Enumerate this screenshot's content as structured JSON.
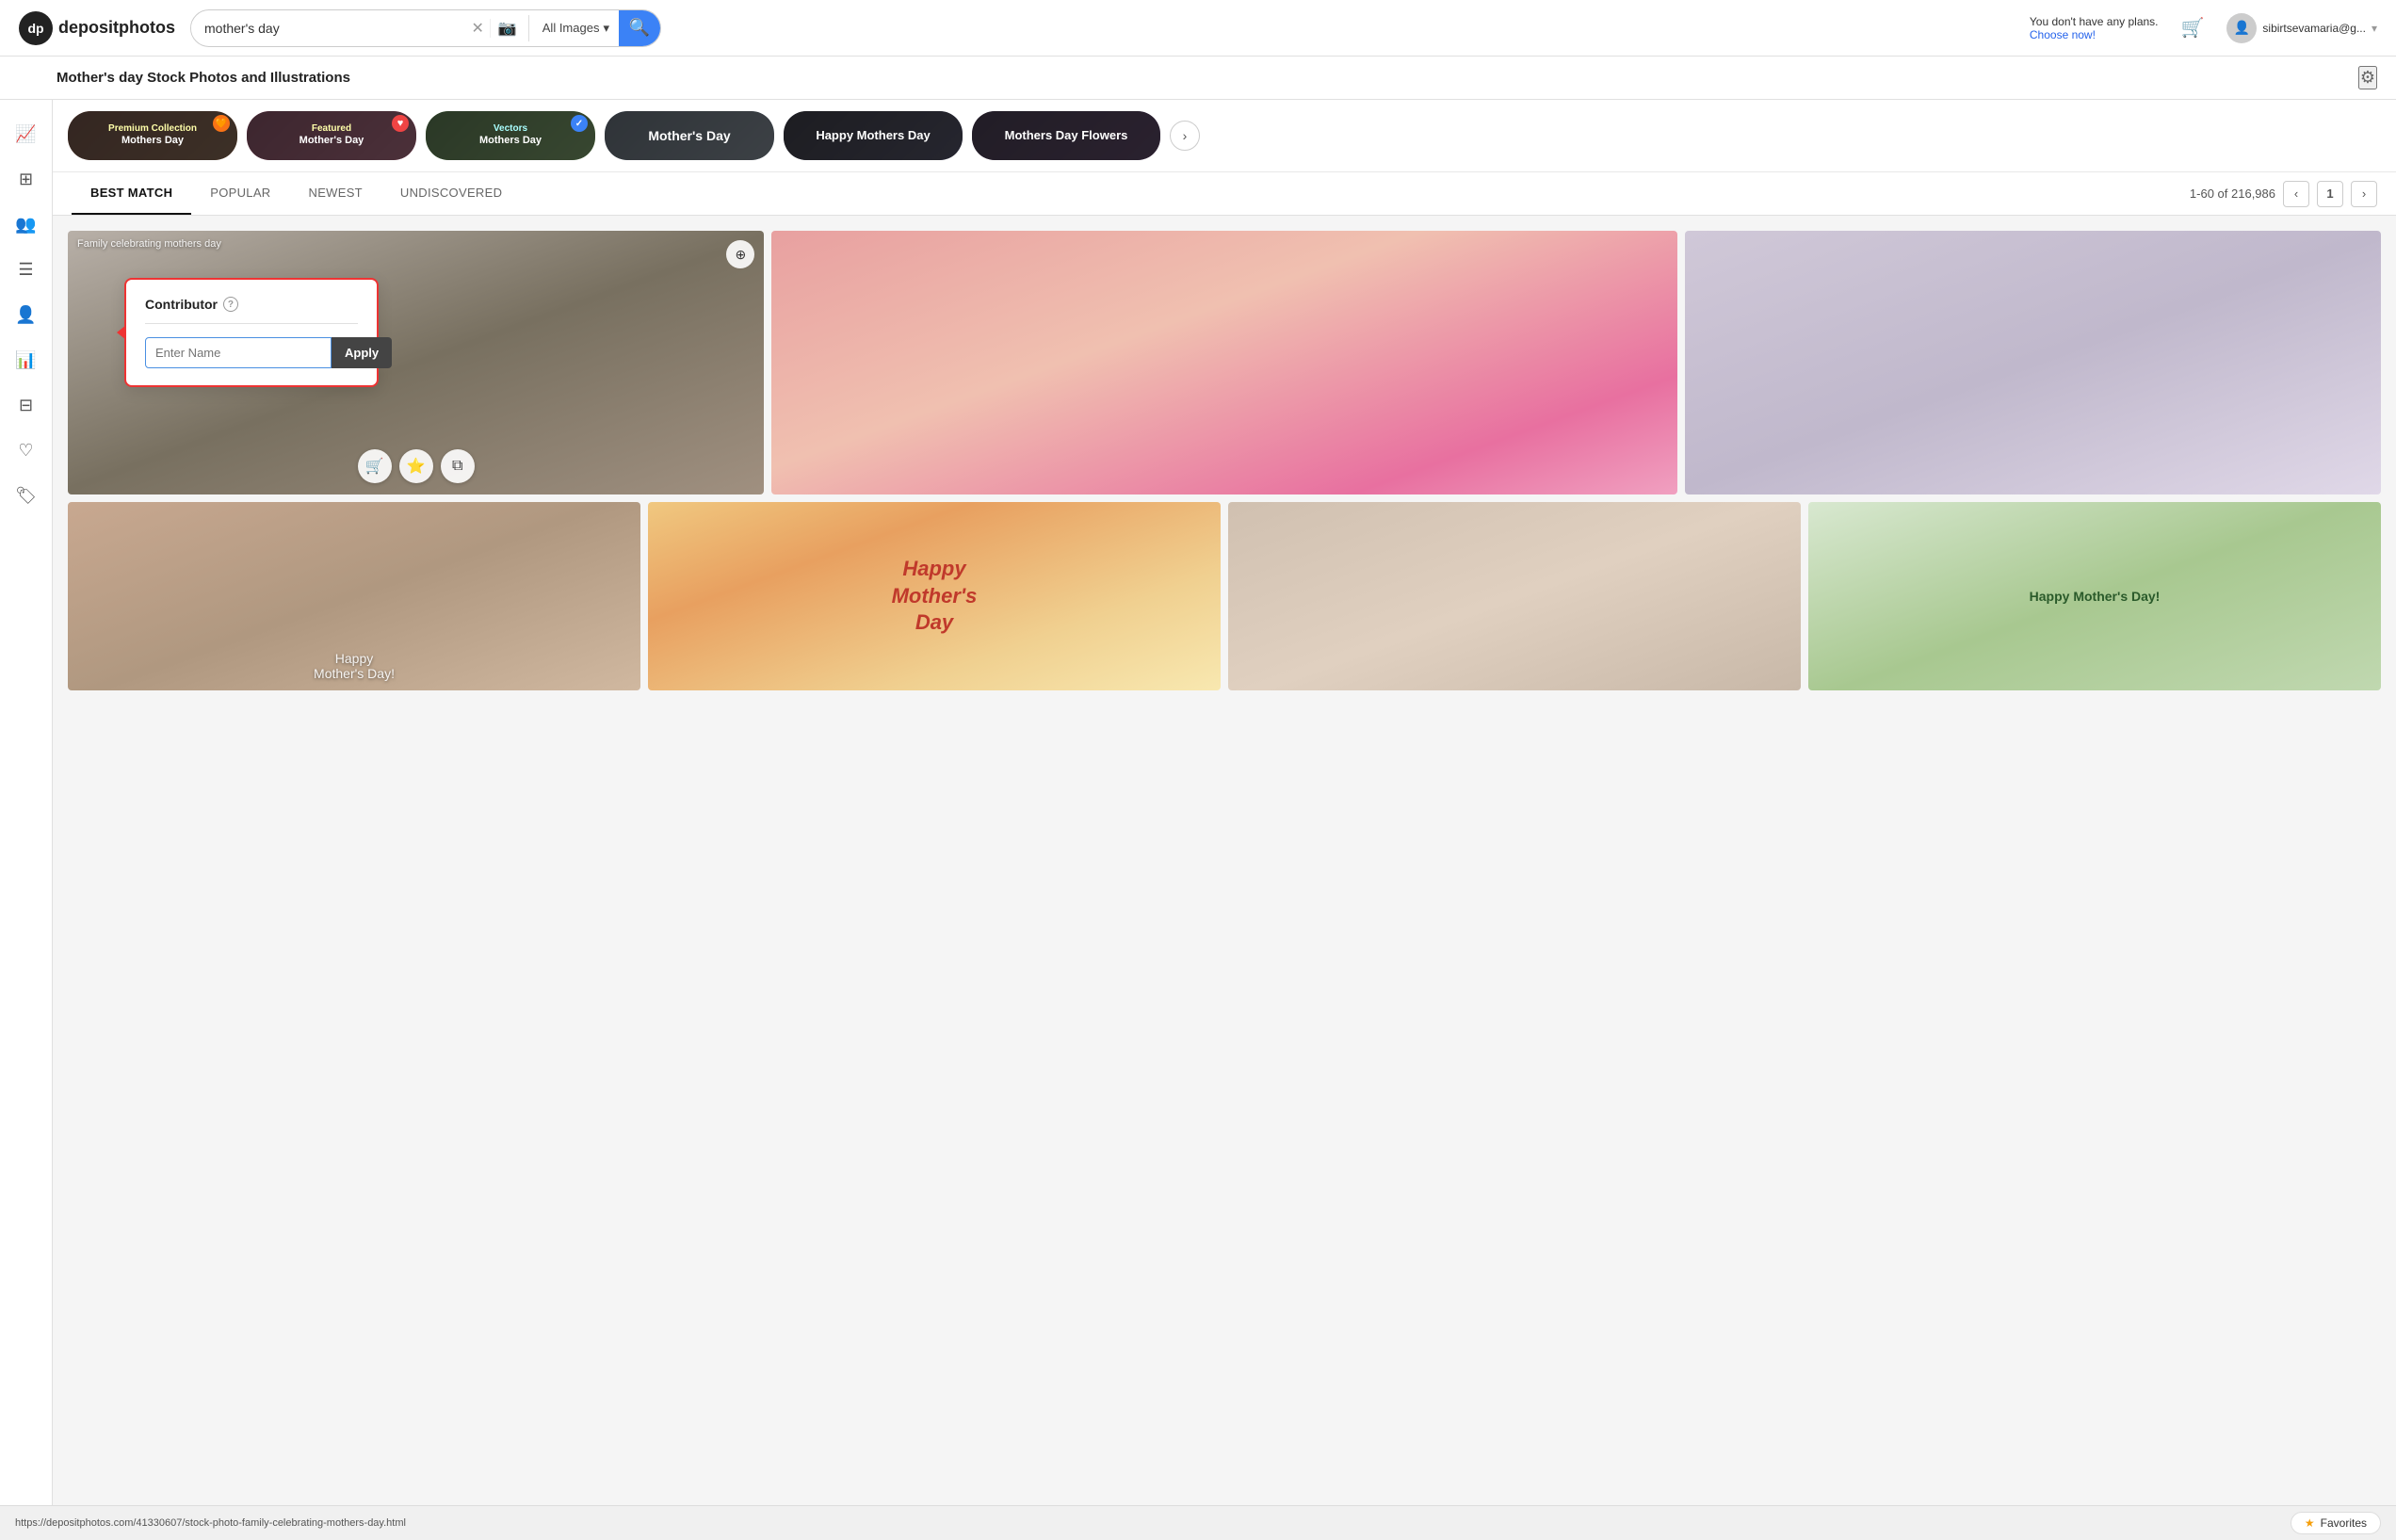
{
  "header": {
    "logo_text": "depositphotos",
    "search_value": "mother's day",
    "search_placeholder": "mother's day",
    "all_images_label": "All Images",
    "plans_text": "You don't have any plans.",
    "plans_cta": "Choose now!",
    "user_email": "sibirtsevamaria@g...",
    "search_icon": "🔍",
    "camera_icon": "📷",
    "cart_icon": "🛒",
    "chevron_icon": "▾"
  },
  "sub_header": {
    "title": "Mother's day Stock Photos and Illustrations",
    "settings_icon": "⚙"
  },
  "collection_tags": [
    {
      "id": "premium",
      "label1": "Premium Collection",
      "label2": "Mothers Day",
      "badge": "🧡",
      "badge_color": "#f97316",
      "bg_class": "tag-bg-1"
    },
    {
      "id": "featured",
      "label1": "Featured",
      "label2": "Mother's Day",
      "badge": "❤",
      "badge_color": "#ef4444",
      "bg_class": "tag-bg-2"
    },
    {
      "id": "vectors",
      "label1": "Vectors",
      "label2": "Mothers Day",
      "badge": "✓",
      "badge_color": "#3b82f6",
      "bg_class": "tag-bg-3"
    },
    {
      "id": "mothers-day",
      "label1": "",
      "label2": "Mother's Day",
      "badge": "",
      "badge_color": "",
      "bg_class": "tag-bg-4"
    },
    {
      "id": "happy",
      "label1": "",
      "label2": "Happy Mothers Day",
      "badge": "",
      "badge_color": "",
      "bg_class": "tag-bg-5"
    },
    {
      "id": "flowers",
      "label1": "",
      "label2": "Mothers Day Flowers",
      "badge": "",
      "badge_color": "",
      "bg_class": "tag-bg-6"
    }
  ],
  "collection_nav": {
    "chevron_right": "›"
  },
  "sort_tabs": [
    {
      "id": "best",
      "label": "BEST MATCH",
      "active": true
    },
    {
      "id": "popular",
      "label": "POPULAR",
      "active": false
    },
    {
      "id": "newest",
      "label": "NEWEST",
      "active": false
    },
    {
      "id": "undiscovered",
      "label": "UNDISCOVERED",
      "active": false
    }
  ],
  "pagination": {
    "range": "1-60 of 216,986",
    "current_page": "1",
    "prev_icon": "‹",
    "next_icon": "›"
  },
  "images": [
    {
      "id": "img1",
      "label": "Family celebrating mothers day",
      "bg_class": "img-1"
    },
    {
      "id": "img2",
      "label": "",
      "bg_class": "img-2"
    },
    {
      "id": "img3",
      "label": "",
      "bg_class": "img-3"
    },
    {
      "id": "img4",
      "label": "Happy Mother's Day!",
      "bg_class": "img-4"
    },
    {
      "id": "img5",
      "label": "Happy Mother's Day",
      "bg_class": "img-5"
    },
    {
      "id": "img6",
      "label": "",
      "bg_class": "img-6"
    },
    {
      "id": "img7",
      "label": "Happy Mother's Day!",
      "bg_class": "img-7"
    }
  ],
  "contributor_popup": {
    "title": "Contributor",
    "help_icon": "?",
    "input_placeholder": "Enter Name",
    "apply_label": "Apply"
  },
  "image_actions": [
    {
      "id": "cart",
      "icon": "🛒"
    },
    {
      "id": "star",
      "icon": "⭐"
    },
    {
      "id": "copy",
      "icon": "⧉"
    }
  ],
  "sidebar_items": [
    {
      "id": "trending",
      "icon": "📈"
    },
    {
      "id": "grid",
      "icon": "⊞"
    },
    {
      "id": "people",
      "icon": "👥"
    },
    {
      "id": "list",
      "icon": "☰"
    },
    {
      "id": "user-circle",
      "icon": "👤"
    },
    {
      "id": "chart-bar",
      "icon": "📊"
    },
    {
      "id": "table",
      "icon": "⊟"
    },
    {
      "id": "heart",
      "icon": "♡"
    },
    {
      "id": "tag",
      "icon": "🏷"
    }
  ],
  "status_bar": {
    "url": "https://depositphotos.com/41330607/stock-photo-family-celebrating-mothers-day.html",
    "favorites_label": "Favorites",
    "star_icon": "★"
  }
}
